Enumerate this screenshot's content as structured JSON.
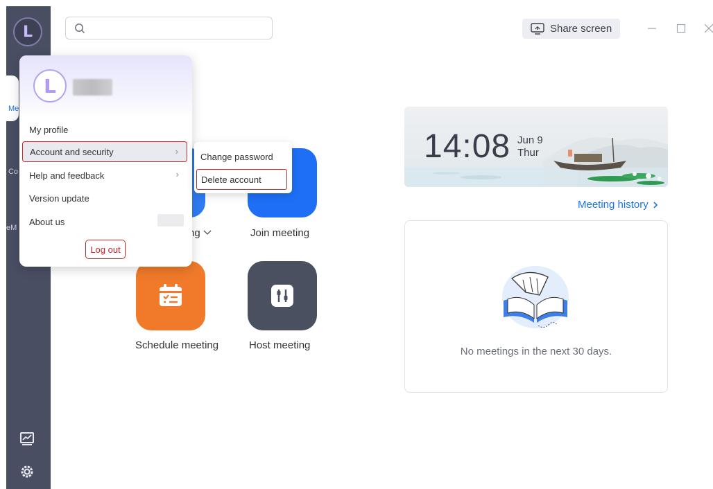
{
  "sidebar": {
    "logo_letter": "L",
    "fragments": [
      "Me",
      "Co",
      "eM"
    ]
  },
  "search": {
    "placeholder": ""
  },
  "header": {
    "share_screen_label": "Share screen"
  },
  "actions": {
    "join_meeting": "Join meeting",
    "schedule_meeting": "Schedule meeting",
    "host_meeting": "Host meeting",
    "partial_label": "ng"
  },
  "clock": {
    "time": "14:08",
    "date": "Jun 9",
    "weekday": "Thur"
  },
  "history": {
    "link_label": "Meeting history"
  },
  "empty_state": {
    "message": "No meetings in the next 30 days."
  },
  "profile_menu": {
    "avatar_letter": "L",
    "items": [
      {
        "label": "My profile"
      },
      {
        "label": "Account and security"
      },
      {
        "label": "Help and feedback"
      },
      {
        "label": "Version update"
      },
      {
        "label": "About us"
      }
    ],
    "logout_label": "Log out"
  },
  "submenu": {
    "items": [
      {
        "label": "Change password"
      },
      {
        "label": "Delete account"
      }
    ]
  },
  "colors": {
    "sidebar_bg": "#4a4e63",
    "accent_blue": "#1a73e8",
    "highlight_red": "#c0262c",
    "schedule_orange": "#f07a2a",
    "host_gray": "#4b5060"
  },
  "icons": [
    "search-icon",
    "share-screen-icon",
    "minimize-icon",
    "maximize-icon",
    "close-icon",
    "chevron-right-icon",
    "calendar-icon",
    "host-controls-icon",
    "chart-icon",
    "gear-icon",
    "chevron-down-icon"
  ]
}
